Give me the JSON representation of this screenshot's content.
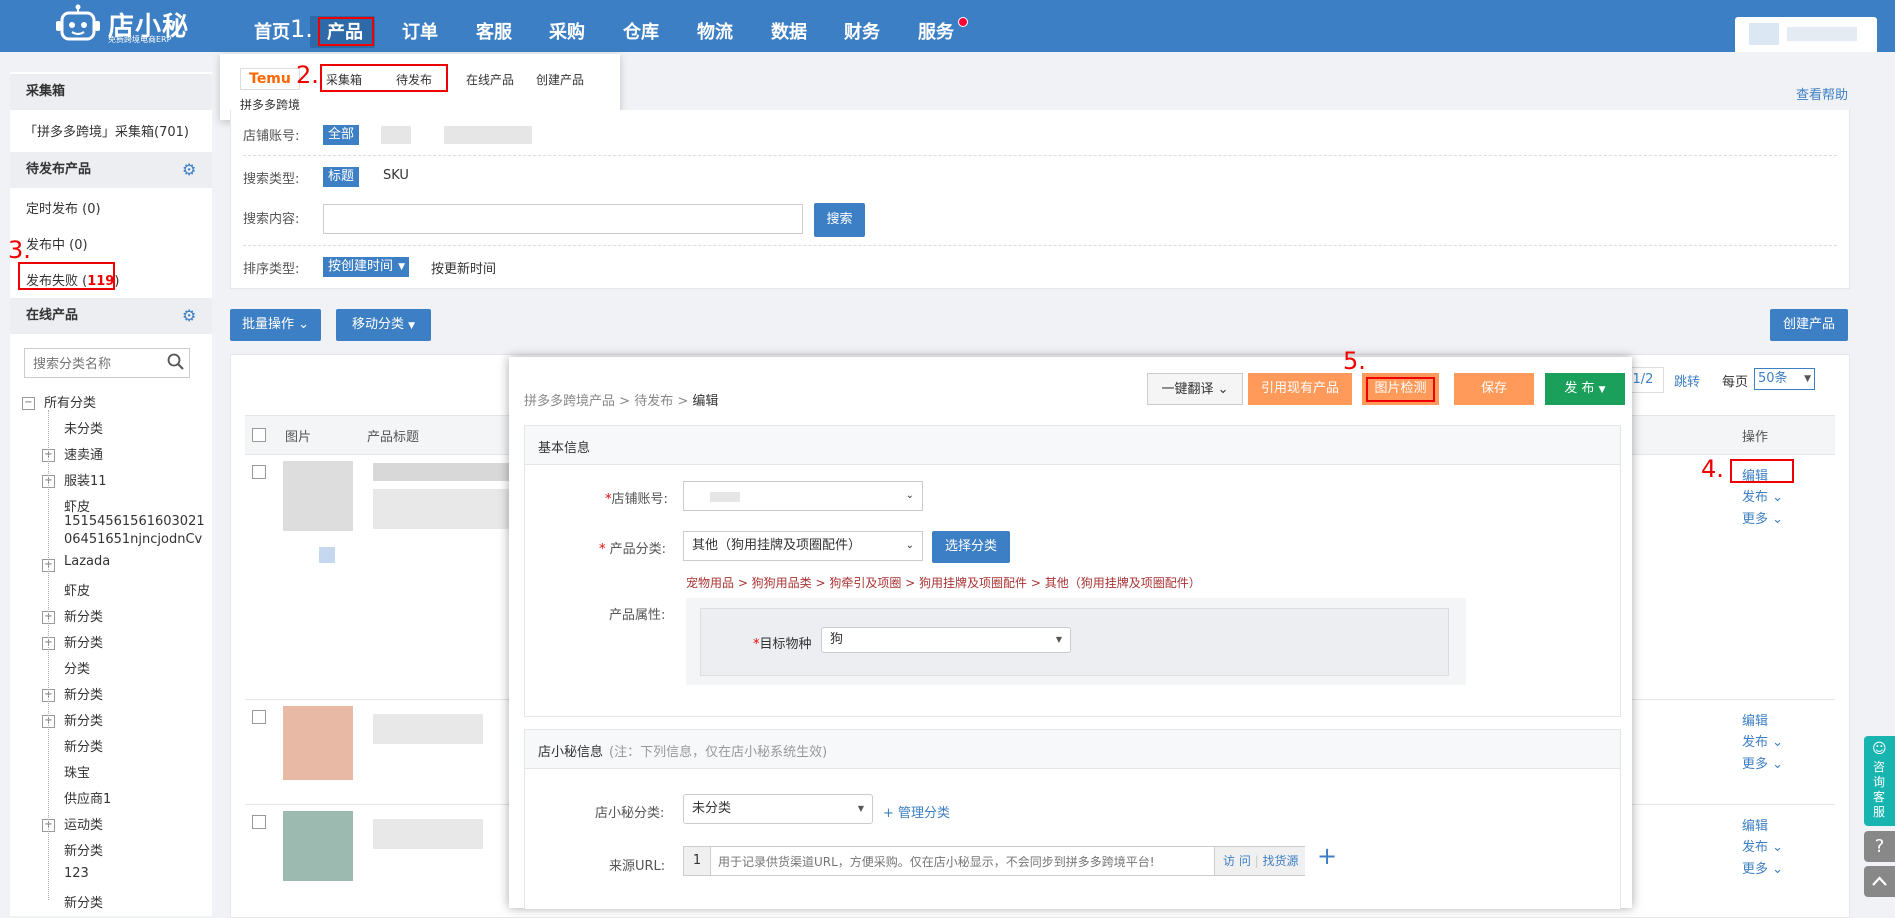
{
  "brand": {
    "name": "店小秘",
    "subtitle": "免费跨境电商ERP"
  },
  "nav": {
    "items": [
      "首页",
      "产品",
      "订单",
      "客服",
      "采购",
      "仓库",
      "物流",
      "数据",
      "财务",
      "服务"
    ],
    "active": "产品"
  },
  "annotations": {
    "a1": "1.",
    "a2": "2.",
    "a3": "3.",
    "a4": "4.",
    "a5": "5."
  },
  "product_menu": {
    "platform": "Temu",
    "platform_name": "拼多多跨境",
    "items": [
      "采集箱",
      "待发布",
      "在线产品",
      "创建产品"
    ]
  },
  "help_link": "查看帮助",
  "sidebar": {
    "collect_title": "采集箱",
    "collect_item": "「拼多多跨境」采集箱(701)",
    "pending_title": "待发布产品",
    "pending_items": {
      "scheduled": "定时发布 (0)",
      "publishing": "发布中 (0)",
      "failed_label": "发布失败 (",
      "failed_count": "119",
      "failed_close": ")"
    },
    "online_title": "在线产品",
    "search_placeholder": "搜索分类名称",
    "tree": [
      "所有分类",
      "未分类",
      "速卖通",
      "服装11",
      "虾皮",
      "15154561561603021",
      "06451651njncjodnCv",
      "Lazada",
      "虾皮",
      "新分类",
      "新分类",
      "分类",
      "新分类",
      "新分类",
      "新分类",
      "珠宝",
      "供应商1",
      "运动类",
      "新分类",
      "123",
      "新分类"
    ]
  },
  "filters": {
    "shop_label": "店铺账号:",
    "shop_all": "全部",
    "search_type_label": "搜索类型:",
    "search_type_title": "标题",
    "search_type_sku": "SKU",
    "content_label": "搜索内容:",
    "search_button": "搜索",
    "sort_label": "排序类型:",
    "sort_created": "按创建时间",
    "sort_updated": "按更新时间"
  },
  "toolbar": {
    "batch": "批量操作",
    "move": "移动分类",
    "create": "创建产品"
  },
  "pagination": {
    "page": "1/2",
    "jump": "跳转",
    "per_page_label": "每页",
    "per_page": "50条"
  },
  "table": {
    "col_image": "图片",
    "col_title": "产品标题",
    "col_action": "操作",
    "actions": {
      "edit": "编辑",
      "publish": "发布",
      "more": "更多"
    }
  },
  "modal": {
    "breadcrumb": [
      "拼多多跨境产品",
      "待发布",
      "编辑"
    ],
    "buttons": {
      "translate": "一键翻译",
      "reference": "引用现有产品",
      "image_check": "图片检测",
      "save": "保存",
      "publish": "发 布"
    },
    "basic": {
      "title": "基本信息",
      "shop_label": "店铺账号:",
      "category_label": "产品分类:",
      "category_value": "其他（狗用挂牌及项圈配件）",
      "choose_category": "选择分类",
      "category_path": "宠物用品 > 狗狗用品类 > 狗牵引及项圈 > 狗用挂牌及项圈配件 > 其他（狗用挂牌及项圈配件）",
      "attr_label": "产品属性:",
      "target_label": "目标物种",
      "target_value": "狗"
    },
    "dxm": {
      "title": "店小秘信息",
      "note": "(注：下列信息，仅在店小秘系统生效)",
      "category_label": "店小秘分类:",
      "category_value": "未分类",
      "manage": "+ 管理分类",
      "url_label": "来源URL:",
      "url_index": "1",
      "url_placeholder": "用于记录供货渠道URL，方便采购。仅在店小秘显示，不会同步到拼多多跨境平台!",
      "visit": "访 问",
      "find_source": "找货源",
      "add": "+"
    }
  },
  "float_service": "咨询客服",
  "colors": {
    "primary": "#3d7fc4",
    "orange": "#ff9a5a",
    "green": "#1aa05a",
    "red": "#e00000"
  }
}
